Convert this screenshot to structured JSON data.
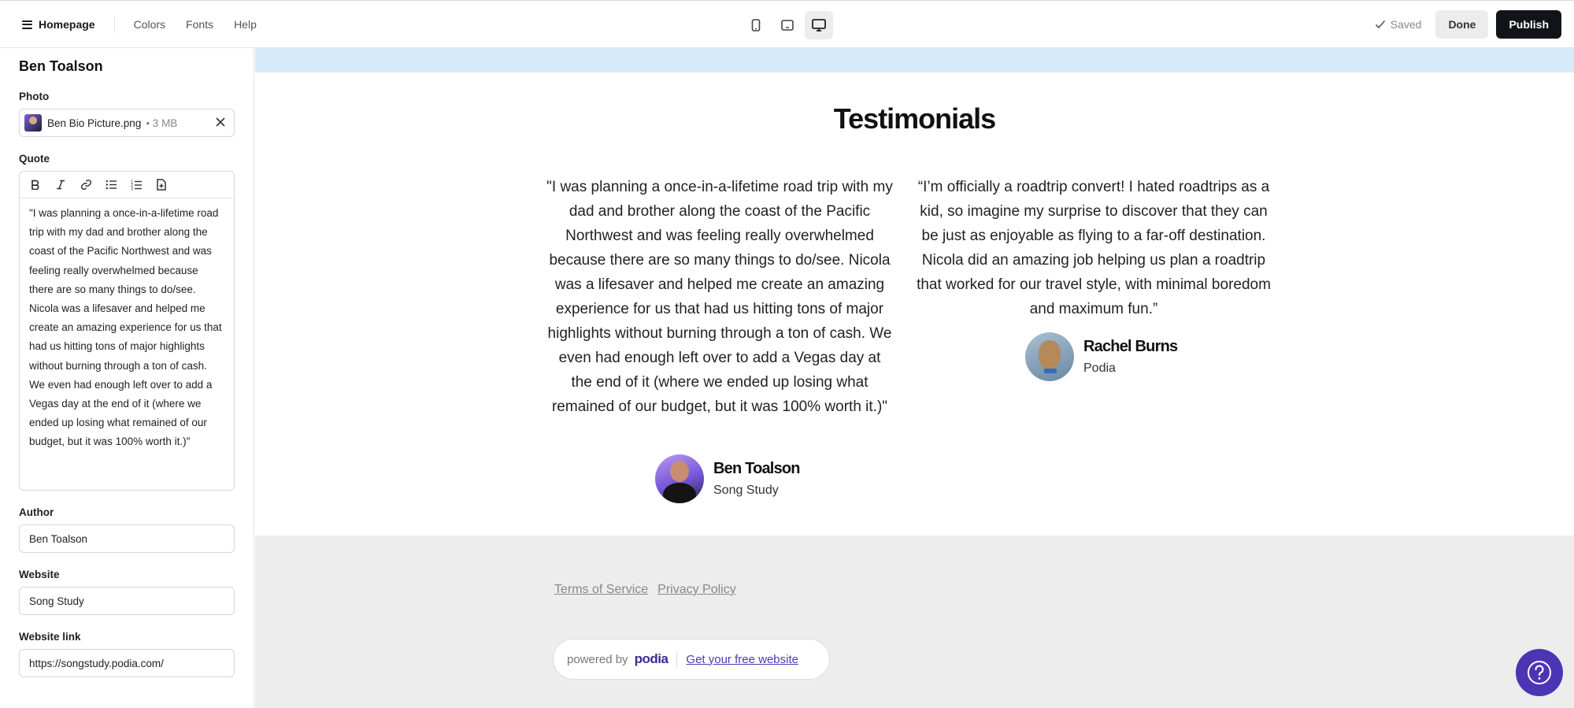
{
  "topbar": {
    "page_menu_label": "Homepage",
    "links": [
      "Colors",
      "Fonts",
      "Help"
    ],
    "saved_label": "Saved",
    "done_label": "Done",
    "publish_label": "Publish",
    "device_icons": [
      "phone-icon",
      "tablet-icon",
      "desktop-icon"
    ],
    "active_device": "desktop"
  },
  "sidebar": {
    "title": "Ben Toalson",
    "photo_label": "Photo",
    "photo_file_name": "Ben Bio Picture.png",
    "photo_file_size": "• 3 MB",
    "quote_label": "Quote",
    "quote_value": "\"I was planning a once-in-a-lifetime road trip with my dad and brother along the coast of the Pacific Northwest and was feeling really overwhelmed because there are so many things to do/see. Nicola was a lifesaver and helped me create an amazing experience for us that had us hitting tons of major highlights without burning through a ton of cash. We even had enough left over to add a Vegas day at the end of it (where we ended up losing what remained of our budget, but it was 100% worth it.)\"",
    "toolbar_tools": [
      "bold",
      "italic",
      "link",
      "bullet-list",
      "numbered-list",
      "insert-file"
    ],
    "author_label": "Author",
    "author_value": "Ben Toalson",
    "website_label": "Website",
    "website_value": "Song Study",
    "website_link_label": "Website link",
    "website_link_value": "https://songstudy.podia.com/"
  },
  "canvas": {
    "section_title": "Testimonials",
    "testimonials": [
      {
        "quote": "\"I was planning a once-in-a-lifetime road trip with my dad and brother along the coast of the Pacific Northwest and was feeling really overwhelmed because there are so many things to do/see. Nicola was a lifesaver and helped me create an amazing experience for us that had us hitting tons of major highlights without burning through a ton of cash. We even had enough left over to add a Vegas day at the end of it (where we ended up losing what remained of our budget, but it was 100% worth it.)\"",
        "name": "Ben Toalson",
        "site": "Song Study"
      },
      {
        "quote": "“I’m officially a roadtrip convert! I hated roadtrips as a kid, so imagine my surprise to discover that they can be just as enjoyable as flying to a far-off destination. Nicola did an amazing job helping us plan a roadtrip that worked for our travel style, with minimal boredom and maximum fun.”",
        "name": "Rachel Burns",
        "site": "Podia"
      }
    ],
    "footer_links": [
      "Terms of Service",
      "Privacy Policy"
    ],
    "powered_by_text": "powered by",
    "powered_by_brand": "podia",
    "powered_by_cta": "Get your free website"
  },
  "colors": {
    "publish_bg": "#101418",
    "banner_strip": "#d6ebf9",
    "footer_bg": "#ededed",
    "brand_purple": "#4b35b5"
  }
}
